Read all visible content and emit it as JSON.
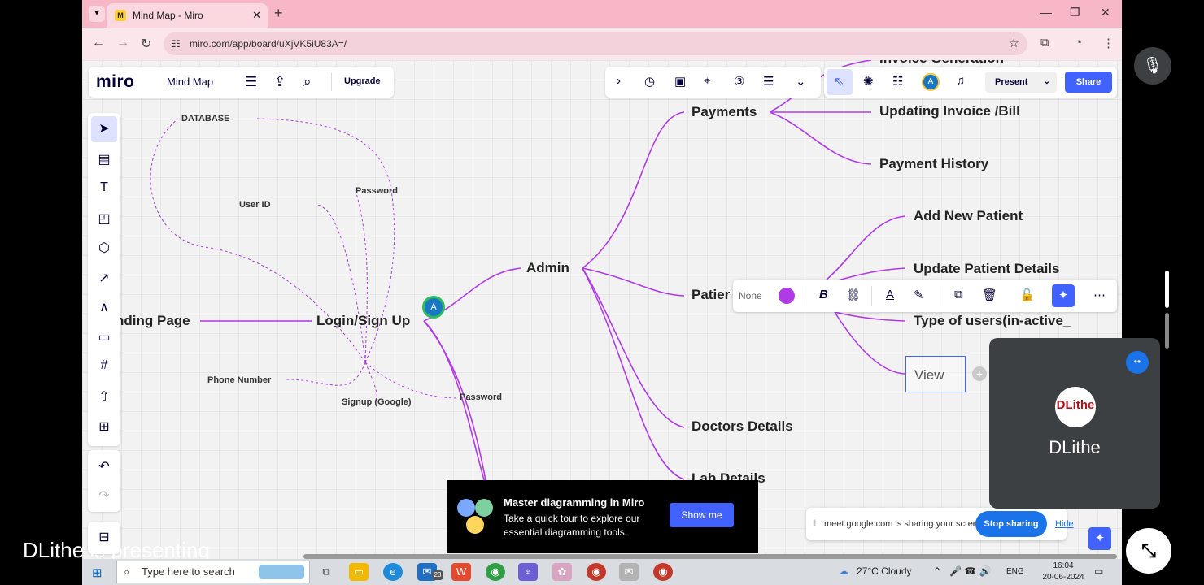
{
  "browser": {
    "tab_title": "Mind Map - Miro",
    "url": "miro.com/app/board/uXjVK5iU83A=/",
    "tab_close": "✕",
    "new_tab": "+"
  },
  "miro": {
    "logo": "miro",
    "board_name": "Mind Map",
    "upgrade_label": "Upgrade",
    "present_label": "Present",
    "share_label": "Share",
    "user_initial": "A"
  },
  "mindmap": {
    "landing": "nding Page",
    "login": "Login/Sign Up",
    "admin": "Admin",
    "payments": "Payments",
    "invoice_generation": "Invoice Generation",
    "updating_invoice": "Updating Invoice /Bill",
    "payment_history": "Payment History",
    "add_new_patient": "Add New Patient",
    "update_patient": "Update Patient Details",
    "patient": "Patier",
    "type_of_users": "Type of users(in-active_",
    "view": "View",
    "doctors_details": "Doctors Details",
    "lab_details": "Lab Details",
    "database": "DATABASE",
    "password_top": "Password",
    "user_id": "User ID",
    "phone_number": "Phone Number",
    "signup_google": "Signup (Google)",
    "password_bottom": "Password"
  },
  "context_toolbar": {
    "none_label": "None",
    "color": "#b03ae6"
  },
  "tour": {
    "title": "Master diagramming in Miro",
    "body": "Take a quick tour to explore our essential diagramming tools.",
    "button": "Show me"
  },
  "meet": {
    "sharing_message": "meet.google.com is sharing your screen.",
    "stop_sharing": "Stop sharing",
    "hide": "Hide",
    "participant_name": "DLithe",
    "logo_text": "DLithe",
    "presenting": "DLithe is presenting"
  },
  "taskbar": {
    "search_placeholder": "Type here to search",
    "weather": "27°C  Cloudy",
    "language": "ENG",
    "time": "16:04",
    "date": "20-06-2024",
    "mail_badge": "23"
  },
  "colors": {
    "branch": "#b03ae6",
    "accent": "#4262ff",
    "tab_bar": "#f7b7c7"
  }
}
